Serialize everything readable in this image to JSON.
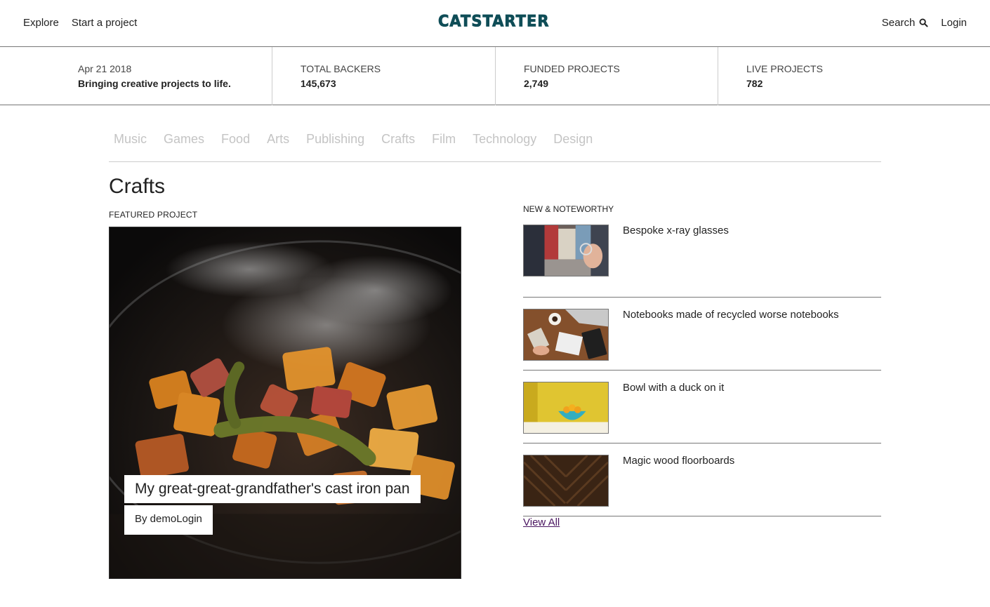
{
  "header": {
    "nav_left": [
      "Explore",
      "Start a project"
    ],
    "logo": "CATSTARTER",
    "search_label": "Search",
    "login_label": "Login"
  },
  "stats": {
    "date": "Apr 21 2018",
    "tagline": "Bringing creative projects to life.",
    "total_backers_label": "TOTAL BACKERS",
    "total_backers_value": "145,673",
    "funded_projects_label": "FUNDED PROJECTS",
    "funded_projects_value": "2,749",
    "live_projects_label": "LIVE PROJECTS",
    "live_projects_value": "782"
  },
  "categories": [
    "Music",
    "Games",
    "Food",
    "Arts",
    "Publishing",
    "Crafts",
    "Film",
    "Technology",
    "Design"
  ],
  "page_title": "Crafts",
  "featured": {
    "label": "FEATURED PROJECT",
    "title": "My great-great-grandfather's cast iron pan",
    "byline": "By demoLogin"
  },
  "noteworthy": {
    "label": "NEW & NOTEWORTHY",
    "items": [
      {
        "title": "Bespoke x-ray glasses"
      },
      {
        "title": "Notebooks made of recycled worse notebooks"
      },
      {
        "title": "Bowl with a duck on it"
      },
      {
        "title": "Magic wood floorboards"
      }
    ],
    "view_all": "View All"
  },
  "colors": {
    "logo": "#0f4d57",
    "category_inactive": "#c4c4c4",
    "link_visited": "#4a1560"
  }
}
